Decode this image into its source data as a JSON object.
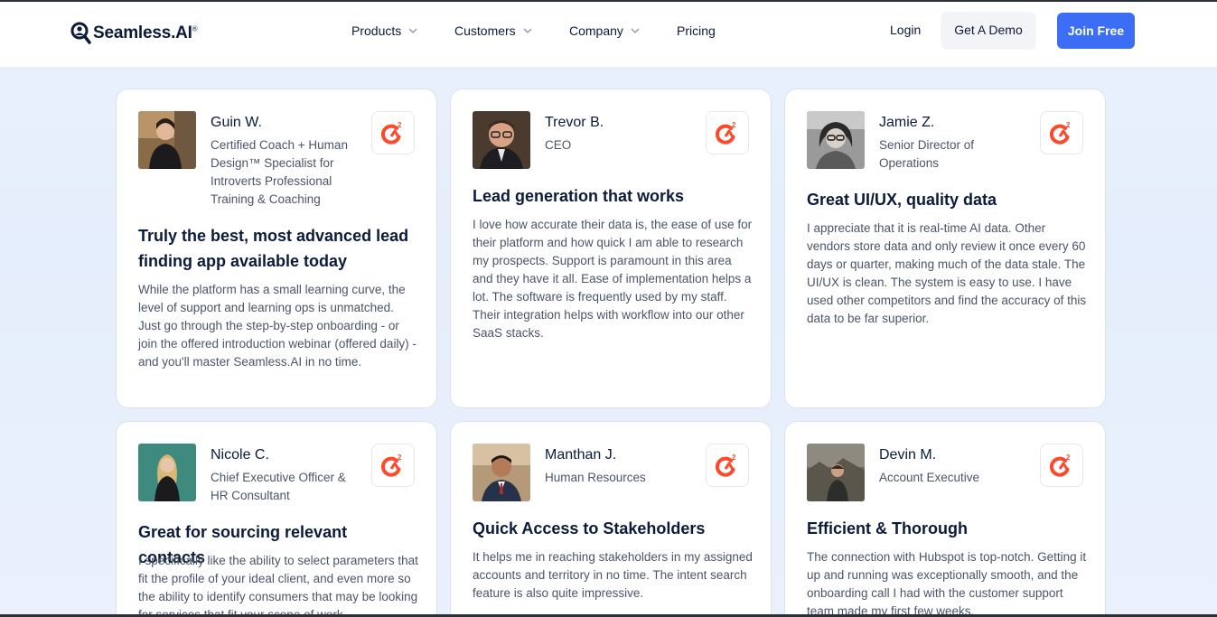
{
  "brand": {
    "name": "Seamless.AI",
    "reg": "®"
  },
  "nav": {
    "items": [
      {
        "label": "Products",
        "has_dropdown": true
      },
      {
        "label": "Customers",
        "has_dropdown": true
      },
      {
        "label": "Company",
        "has_dropdown": true
      },
      {
        "label": "Pricing",
        "has_dropdown": false
      }
    ],
    "login": "Login",
    "demo": "Get A Demo",
    "join": "Join Free"
  },
  "colors": {
    "accent": "#3b6ef5",
    "g2_red": "#ff492c",
    "text_dark": "#0b1b3a",
    "text_muted": "#4a5568"
  },
  "reviews": [
    {
      "name": "Guin W.",
      "role": "Certified Coach + Human Design™ Specialist for Introverts Professional Training & Coaching",
      "title": "Truly the best, most advanced lead finding app available today",
      "body": "While the platform has a small learning curve, the level of support and learning ops is unmatched. Just go through the step-by-step onboarding - or join the offered introduction webinar (offered daily) - and you'll master Seamless.AI in no time.",
      "badge_icon": "g2-logo-icon"
    },
    {
      "name": "Trevor B.",
      "role": "CEO",
      "title": "Lead generation that works",
      "body": "I love how accurate their data is, the ease of use for their platform and how quick I am able to research my prospects. Support is paramount in this area and they have it all. Ease of implementation helps a lot. The software is frequently used by my staff. Their integration helps with workflow into our other SaaS stacks.",
      "badge_icon": "g2-logo-icon"
    },
    {
      "name": "Jamie Z.",
      "role": "Senior Director of Operations",
      "title": "Great UI/UX, quality data",
      "body": "I appreciate that it is real-time AI data. Other vendors store data and only review it once every 60 days or quarter, making much of the data stale. The UI/UX is clean. The system is easy to use. I have used other competitors and find the accuracy of this data to be far superior.",
      "badge_icon": "g2-logo-icon"
    },
    {
      "name": "Nicole C.",
      "role": "Chief Executive Officer & HR Consultant",
      "title": "Great for sourcing relevant contacts",
      "body": "I specifically like the ability to select parameters that fit the profile of your ideal client, and even more so the ability to identify consumers that may be looking for services that fit your scope of work.",
      "badge_icon": "g2-logo-icon"
    },
    {
      "name": "Manthan J.",
      "role": "Human Resources",
      "title": "Quick Access to Stakeholders",
      "body": "It helps me in reaching stakeholders in my assigned accounts and territory in no time. The intent search feature is also quite impressive.",
      "badge_icon": "g2-logo-icon"
    },
    {
      "name": "Devin M.",
      "role": "Account Executive",
      "title": "Efficient & Thorough",
      "body": "The connection with Hubspot is top-notch. Getting it up and running was exceptionally smooth, and the onboarding call I had with the customer support team made my first few weeks.",
      "badge_icon": "g2-logo-icon"
    }
  ]
}
